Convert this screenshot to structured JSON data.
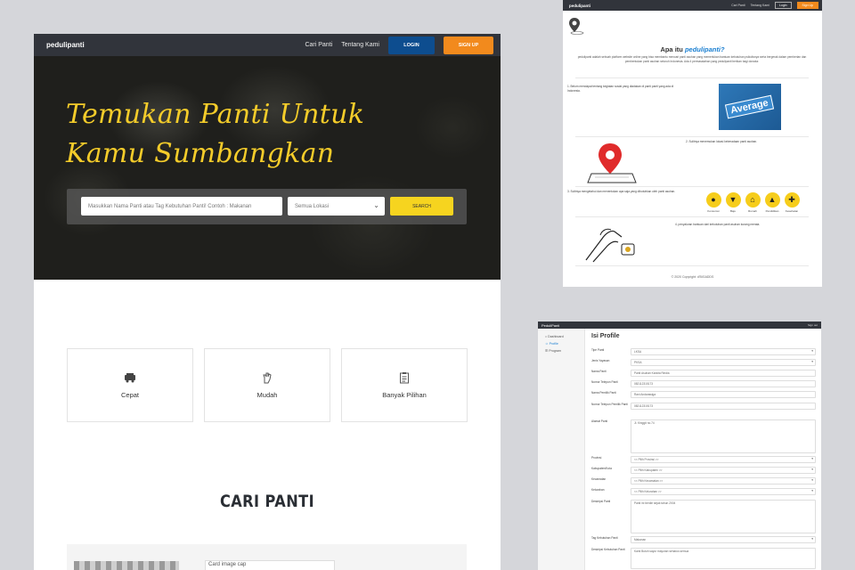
{
  "main": {
    "nav": {
      "logo": "pedulipanti",
      "link_cari": "Cari Panti",
      "link_tentang": "Tentang Kami",
      "login": "LOGIN",
      "signup": "SIGN UP"
    },
    "hero": {
      "title_line1": "Temukan Panti Untuk",
      "title_line2": "Kamu Sumbangkan",
      "search_placeholder": "Masukkan Nama Panti atau Tag Kebutuhan Panti! Contoh : Makanan",
      "location_selected": "Semua Lokasi",
      "search_button": "SEARCH"
    },
    "features": [
      {
        "label": "Cepat",
        "icon": "truck-icon"
      },
      {
        "label": "Mudah",
        "icon": "hand-icon"
      },
      {
        "label": "Banyak Pilihan",
        "icon": "clipboard-icon"
      }
    ],
    "section_title": "CARI PANTI",
    "card_image_alt": "Card image cap"
  },
  "about": {
    "nav": {
      "link_cari": "Cari Panti",
      "link_tentang": "Tentang Kami",
      "login": "Login",
      "signup": "Sign Up"
    },
    "title_prefix": "Apa itu",
    "title_brand": "pedulipanti?",
    "description": "pedulipanti adalah sebuah platform website online yang bisa membantu mencari panti asuhan yang memerlukan bantuan kebutuhan psikolisnya serta bergerak dalam pemberian dan pembentukan panti asuhan seluruh Indonesia. Ada 4 permasalahan yang pedulipanti berikan bagi donatur.",
    "steps": [
      "1. Belum mendapat tentang kegiatan sosial yang diadakan di panti panti yang ada di Indonesia.",
      "2. Sulitnya menemukan lokasi keberadaan panti asuhan.",
      "3. Sulitnya mengetahui dan menentukan apa saja yang dibutuhkan oleh panti asuhan.",
      "4. penyaluran bantuan dari kebutuhan panti asuhan kurang merata."
    ],
    "average_label": "Average",
    "needs": [
      {
        "label": "Konsumsi",
        "icon": "apple-icon"
      },
      {
        "label": "Baju",
        "icon": "shirt-icon"
      },
      {
        "label": "Rumah",
        "icon": "house-icon"
      },
      {
        "label": "Pendidikan",
        "icon": "graduation-icon"
      },
      {
        "label": "Kesehatan",
        "icon": "medical-icon"
      }
    ],
    "copyright": "© 2020 Copyright: d'BIGADDS"
  },
  "admin": {
    "logo": "PeduliPanti",
    "logout": "Sign out",
    "menu": [
      "Dashboard",
      "Profile",
      "Program"
    ],
    "title": "Isi Profile",
    "fields": [
      {
        "label": "Tipe Panti",
        "value": "LKSA"
      },
      {
        "label": "Jenis Yayasan",
        "value": "PKSA"
      },
      {
        "label": "Nama Panti",
        "value": "Panti Asuhan Karsita Rindia"
      },
      {
        "label": "Nomor Telepon Panti",
        "value": "082112315173"
      },
      {
        "label": "Nama Pemilik Panti",
        "value": "Rani Andarawiga"
      },
      {
        "label": "Nomor Telepon Pemilik Panti",
        "value": "082112315173"
      },
      {
        "label": "Alamat Panti",
        "value": "Jl. Kinggit no.74"
      },
      {
        "label": "Provinsi",
        "value": "<< Pilih Provinsi >>"
      },
      {
        "label": "Kabupaten/Kota",
        "value": "<< Pilih Kabupaten >>"
      },
      {
        "label": "Kecamatan",
        "value": "<< Pilih Kecamatan >>"
      },
      {
        "label": "Kelurahan",
        "value": "<< Pilih Kelurahan >>"
      },
      {
        "label": "Deskripsi Panti",
        "value": "Panti ini berdiri sejak tahun 2004"
      },
      {
        "label": "Tag Kebutuhan Panti",
        "value": "Makanan"
      },
      {
        "label": "Deskripsi Kebutuhan Panti",
        "value": "Kami Butuh sayur mayuran seharus semua"
      }
    ]
  }
}
